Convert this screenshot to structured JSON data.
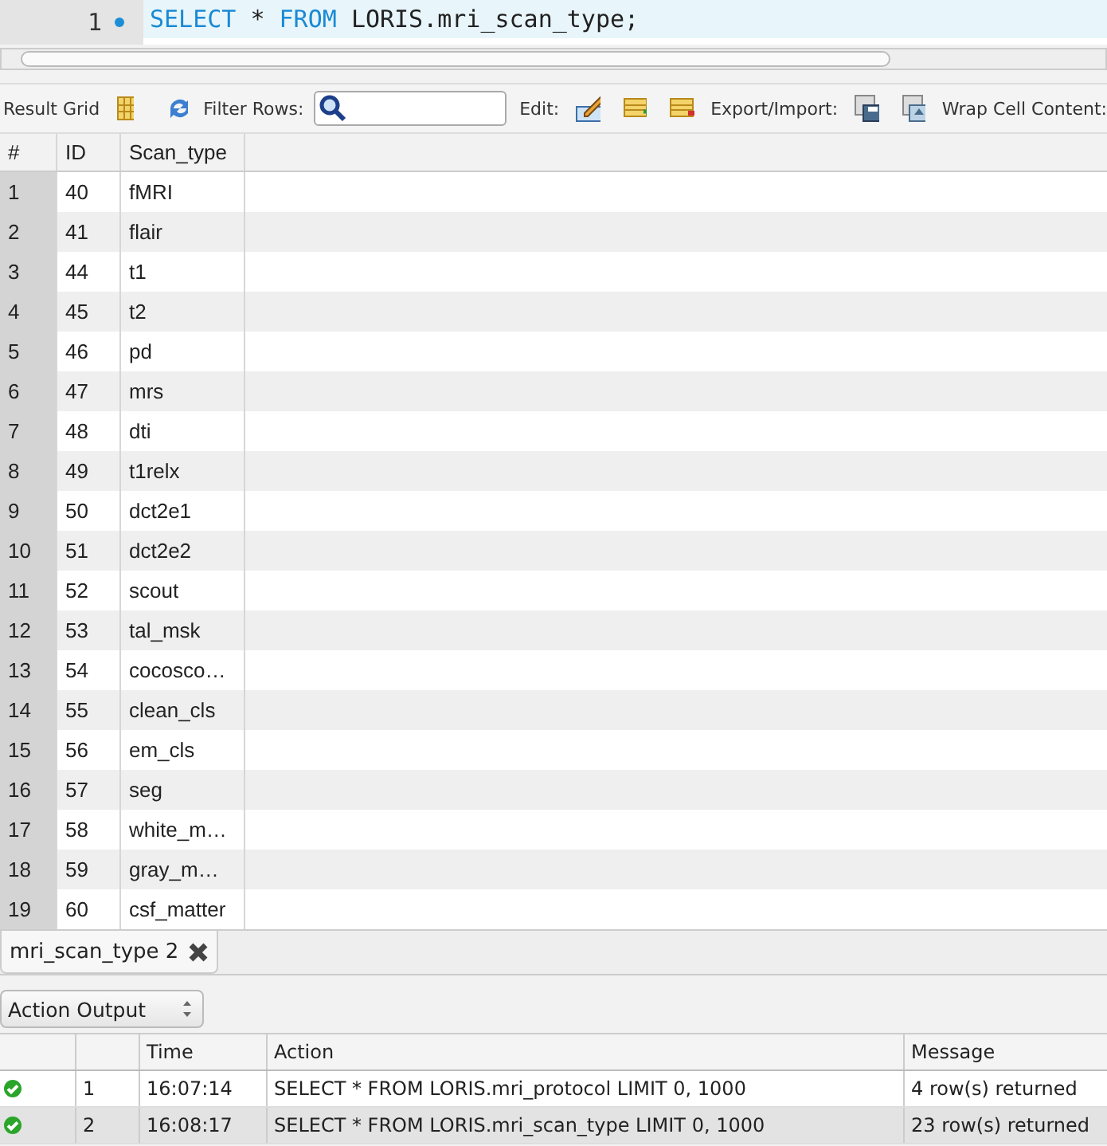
{
  "editor": {
    "line_number": "1",
    "tokens": [
      {
        "text": "SELECT",
        "kind": "keyword"
      },
      {
        "text": "*",
        "kind": "plain"
      },
      {
        "text": "FROM",
        "kind": "keyword"
      },
      {
        "text": "LORIS.mri_scan_type;",
        "kind": "plain"
      }
    ]
  },
  "toolbar": {
    "result_grid": "Result Grid",
    "filter_rows": "Filter Rows:",
    "edit": "Edit:",
    "export_import": "Export/Import:",
    "wrap": "Wrap Cell Content:"
  },
  "grid": {
    "columns": [
      "#",
      "ID",
      "Scan_type"
    ],
    "rows": [
      [
        "1",
        "40",
        "fMRI"
      ],
      [
        "2",
        "41",
        "flair"
      ],
      [
        "3",
        "44",
        "t1"
      ],
      [
        "4",
        "45",
        "t2"
      ],
      [
        "5",
        "46",
        "pd"
      ],
      [
        "6",
        "47",
        "mrs"
      ],
      [
        "7",
        "48",
        "dti"
      ],
      [
        "8",
        "49",
        "t1relx"
      ],
      [
        "9",
        "50",
        "dct2e1"
      ],
      [
        "10",
        "51",
        "dct2e2"
      ],
      [
        "11",
        "52",
        "scout"
      ],
      [
        "12",
        "53",
        "tal_msk"
      ],
      [
        "13",
        "54",
        "cocosco…"
      ],
      [
        "14",
        "55",
        "clean_cls"
      ],
      [
        "15",
        "56",
        "em_cls"
      ],
      [
        "16",
        "57",
        "seg"
      ],
      [
        "17",
        "58",
        "white_m…"
      ],
      [
        "18",
        "59",
        "gray_m…"
      ],
      [
        "19",
        "60",
        "csf_matter"
      ]
    ]
  },
  "result_tab": {
    "label": "mri_scan_type 2"
  },
  "output_select": {
    "value": "Action Output"
  },
  "output": {
    "columns": [
      "Time",
      "Action",
      "Message"
    ],
    "rows": [
      {
        "kind": "success",
        "index": "1",
        "time": "16:07:14",
        "action": "SELECT * FROM LORIS.mri_protocol LIMIT 0, 1000",
        "message": "4 row(s) returned",
        "selected": false
      },
      {
        "kind": "success",
        "index": "2",
        "time": "16:08:17",
        "action": "SELECT * FROM LORIS.mri_scan_type LIMIT 0, 1000",
        "message": "23 row(s) returned",
        "selected": true
      }
    ]
  }
}
